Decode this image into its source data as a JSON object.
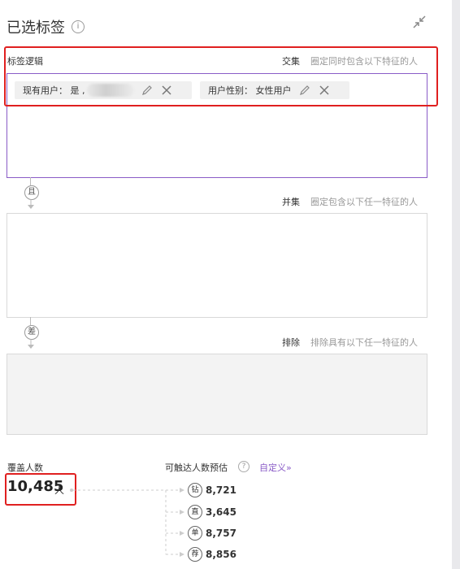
{
  "header": {
    "title": "已选标签",
    "info_icon": "info-icon",
    "collapse_icon": "collapse-icon"
  },
  "intersection": {
    "label": "标签逻辑",
    "mode": "交集",
    "hint": "圈定同时包含以下特征的人",
    "chips": [
      {
        "text": "现有用户： 是 ,"
      },
      {
        "text": "用户性别： 女性用户"
      }
    ]
  },
  "union": {
    "connector": "且",
    "mode": "并集",
    "hint": "圈定包含以下任一特征的人"
  },
  "exclude": {
    "connector": "差",
    "mode": "排除",
    "hint": "排除具有以下任一特征的人"
  },
  "coverage": {
    "label": "覆盖人数",
    "value": "10,485",
    "unit": "人"
  },
  "reach": {
    "label": "可触达人数预估",
    "help_icon": "?",
    "custom_link": "自定义»",
    "channels": [
      {
        "badge": "钻",
        "value": "8,721"
      },
      {
        "badge": "直",
        "value": "3,645"
      },
      {
        "badge": "单",
        "value": "8,757"
      },
      {
        "badge": "荐",
        "value": "8,856"
      }
    ]
  },
  "colors": {
    "accent": "#8a5cc7",
    "highlight": "#e02020"
  }
}
